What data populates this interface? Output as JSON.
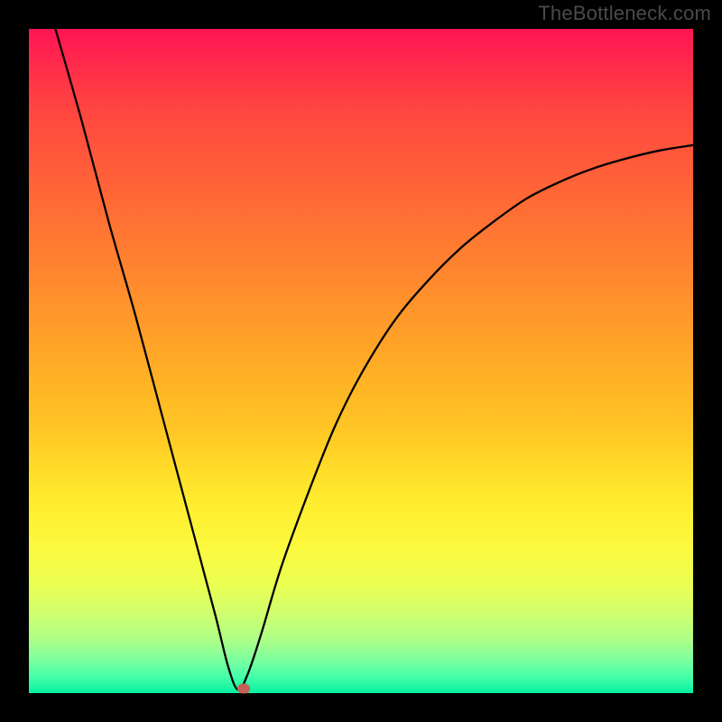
{
  "watermark": "TheBottleneck.com",
  "chart_data": {
    "type": "line",
    "title": "",
    "xlabel": "",
    "ylabel": "",
    "xlim": [
      0,
      100
    ],
    "ylim": [
      0,
      100
    ],
    "grid": false,
    "series": [
      {
        "name": "curve",
        "x": [
          4,
          8,
          12,
          16,
          20,
          24,
          28,
          30,
          31.5,
          33,
          35,
          38,
          42,
          46,
          50,
          55,
          60,
          65,
          70,
          75,
          80,
          85,
          90,
          95,
          100
        ],
        "y": [
          100,
          86,
          71,
          57,
          42,
          27,
          12,
          4,
          0.5,
          3,
          9,
          19,
          30,
          40,
          48,
          56,
          62,
          67,
          71,
          74.5,
          77,
          79,
          80.5,
          81.7,
          82.5
        ]
      }
    ],
    "marker": {
      "x": 32.4,
      "y": 0.7
    },
    "background": "rainbow-gradient-red-to-green-vertical"
  }
}
